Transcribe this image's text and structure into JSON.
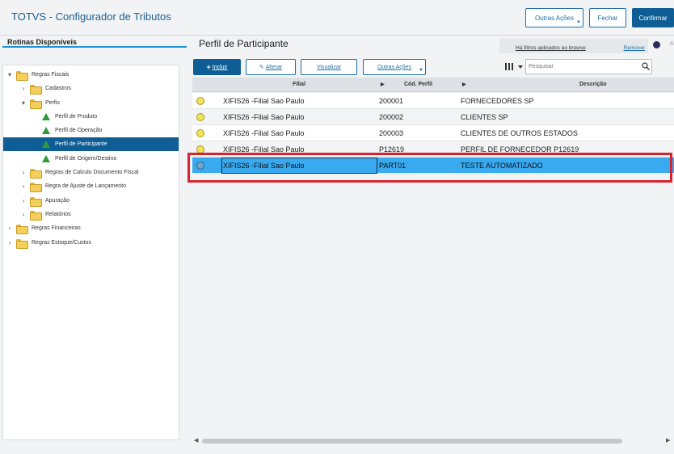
{
  "app": {
    "title": "TOTVS - Configurador de Tributos"
  },
  "header": {
    "other_actions_label": "Outras Ações",
    "close_label": "Fechar",
    "confirm_label": "Confirmar"
  },
  "left": {
    "title": "Rotinas Disponíveis",
    "tree": [
      {
        "label": "Regras Fiscais",
        "toggle": "▾"
      },
      {
        "label": "Cadastros",
        "toggle": "›"
      },
      {
        "label": "Perfis",
        "toggle": "▾"
      },
      {
        "label": "Perfil de Produto"
      },
      {
        "label": "Perfil de Operação"
      },
      {
        "label": "Perfil de Participante"
      },
      {
        "label": "Perfil de Origem/Destino"
      },
      {
        "label": "Regras de Calculo Documento Fiscal",
        "toggle": "›"
      },
      {
        "label": "Regra de Ajuste de Lançamento",
        "toggle": "›"
      },
      {
        "label": "Apuração",
        "toggle": "›"
      },
      {
        "label": "Relatórios",
        "toggle": "›"
      },
      {
        "label": "Regras Financeiras",
        "toggle": "›"
      },
      {
        "label": "Regras Estoque/Custos",
        "toggle": "›"
      }
    ]
  },
  "main": {
    "title": "Perfil de Participante",
    "filter_text": "Há filtros aplicados ao browse",
    "filter_remove": "Remover",
    "right_cut_text": "A",
    "toolbar": {
      "include_icon": "+",
      "include_label": "Incluir",
      "edit_icon": "✎",
      "edit_label": "Alterar",
      "view_label": "Visualizar",
      "other_actions_label": "Outras Ações"
    },
    "search": {
      "placeholder": "Pesquisar"
    },
    "columns": {
      "filial": "Filial",
      "cod": "Cód. Perfil",
      "desc": "Descrição"
    },
    "rows": [
      {
        "filial": "XIFIS26 -Filial Sao Paulo",
        "cod": "200001",
        "desc": "FORNECEDORES SP"
      },
      {
        "filial": "XIFIS26 -Filial Sao Paulo",
        "cod": "200002",
        "desc": "CLIENTES SP"
      },
      {
        "filial": "XIFIS26 -Filial Sao Paulo",
        "cod": "200003",
        "desc": "CLIENTES DE OUTROS ESTADOS"
      },
      {
        "filial": "XIFIS26 -Filial Sao Paulo",
        "cod": "P12619",
        "desc": "PERFIL DE FORNECEDOR P12619"
      },
      {
        "filial": "XIFIS26 -Filial Sao Paulo",
        "cod": "PART01",
        "desc": "TESTE AUTOMATIZADO"
      }
    ],
    "selected_row": 5
  },
  "colors": {
    "brand": "#0e5e95",
    "selection": "#3aaaf0",
    "highlight": "#d9232e"
  }
}
